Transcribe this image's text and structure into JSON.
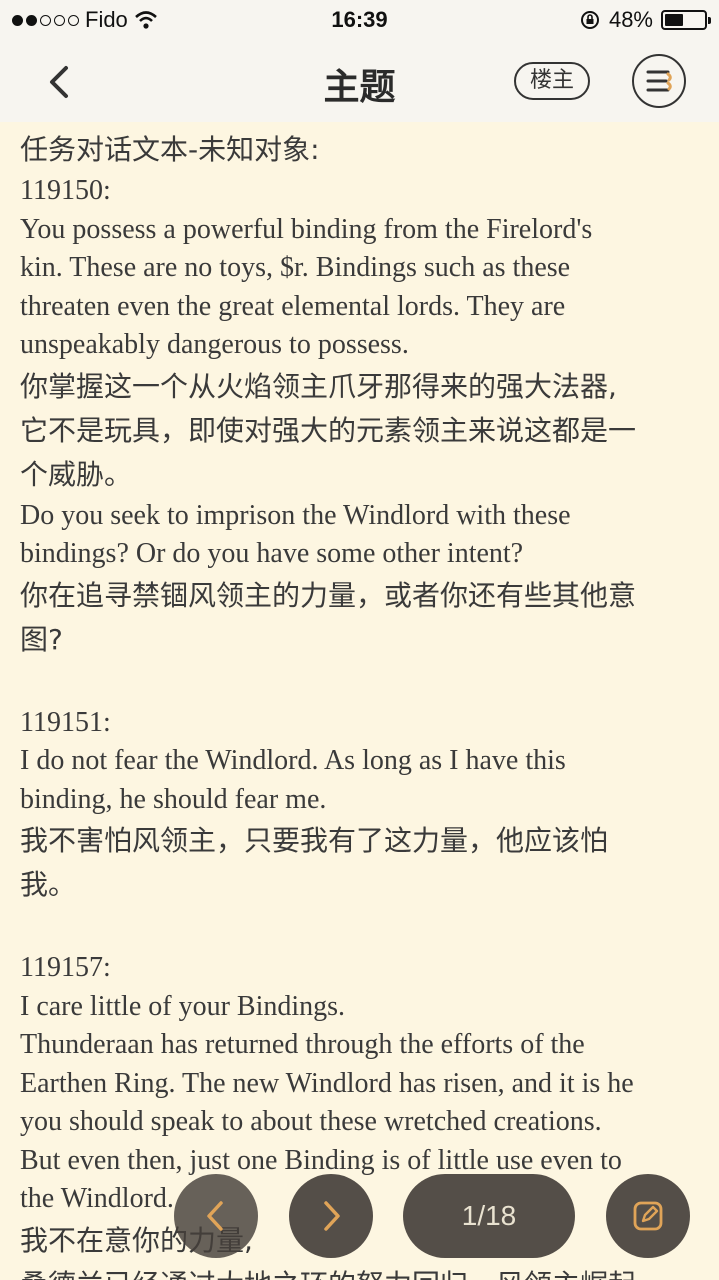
{
  "status_bar": {
    "carrier": "Fido",
    "time": "16:39",
    "battery_percent": "48%",
    "battery_level": 0.48
  },
  "nav": {
    "title": "主题",
    "author_button": "楼主"
  },
  "content": {
    "lines": [
      {
        "lang": "cn",
        "text": "任务对话文本-未知对象:"
      },
      {
        "lang": "en",
        "text": "119150:"
      },
      {
        "lang": "en",
        "text": "You possess a powerful binding from the Firelord's"
      },
      {
        "lang": "en",
        "text": "kin. These are no toys, $r. Bindings such as these"
      },
      {
        "lang": "en",
        "text": "threaten even the great elemental lords. They are"
      },
      {
        "lang": "en",
        "text": "unspeakably dangerous to possess."
      },
      {
        "lang": "cn",
        "text": "你掌握这一个从火焰领主爪牙那得来的强大法器,"
      },
      {
        "lang": "cn",
        "text": "它不是玩具，即使对强大的元素领主来说这都是一"
      },
      {
        "lang": "cn",
        "text": "个威胁。"
      },
      {
        "lang": "en",
        "text": "Do you seek to imprison the Windlord with these"
      },
      {
        "lang": "en",
        "text": "bindings? Or do you have some other intent?"
      },
      {
        "lang": "cn",
        "text": "你在追寻禁锢风领主的力量，或者你还有些其他意"
      },
      {
        "lang": "cn",
        "text": "图?"
      },
      {
        "lang": "gap",
        "text": ""
      },
      {
        "lang": "en",
        "text": "119151:"
      },
      {
        "lang": "en",
        "text": "I do not fear the Windlord. As long as I have this"
      },
      {
        "lang": "en",
        "text": "binding, he should fear me."
      },
      {
        "lang": "cn",
        "text": "我不害怕风领主，只要我有了这力量，他应该怕"
      },
      {
        "lang": "cn",
        "text": "我。"
      },
      {
        "lang": "gap",
        "text": ""
      },
      {
        "lang": "en",
        "text": "119157:"
      },
      {
        "lang": "en",
        "text": "I care little of your Bindings."
      },
      {
        "lang": "en",
        "text": "Thunderaan has returned through the efforts of the"
      },
      {
        "lang": "en",
        "text": "Earthen Ring. The new Windlord has risen, and it is he"
      },
      {
        "lang": "en",
        "text": "you should speak to about these wretched creations."
      },
      {
        "lang": "en",
        "text": "But even then, just one Binding is of little use even to"
      },
      {
        "lang": "en",
        "text": "the Windlord."
      },
      {
        "lang": "cn",
        "text": "我不在意你的力量,"
      },
      {
        "lang": "cn",
        "text": "桑德兰已经通过大地之环的努力回归，风领主崛起"
      }
    ]
  },
  "toolbar": {
    "prev_icon": "chevron-left-icon",
    "next_icon": "chevron-right-icon",
    "page_indicator": "1/18",
    "edit_icon": "edit-icon"
  },
  "colors": {
    "background": "#fdf6e1",
    "bar_background": "#f7f5f0",
    "accent": "#e0a458",
    "fab": "#3c3732"
  }
}
